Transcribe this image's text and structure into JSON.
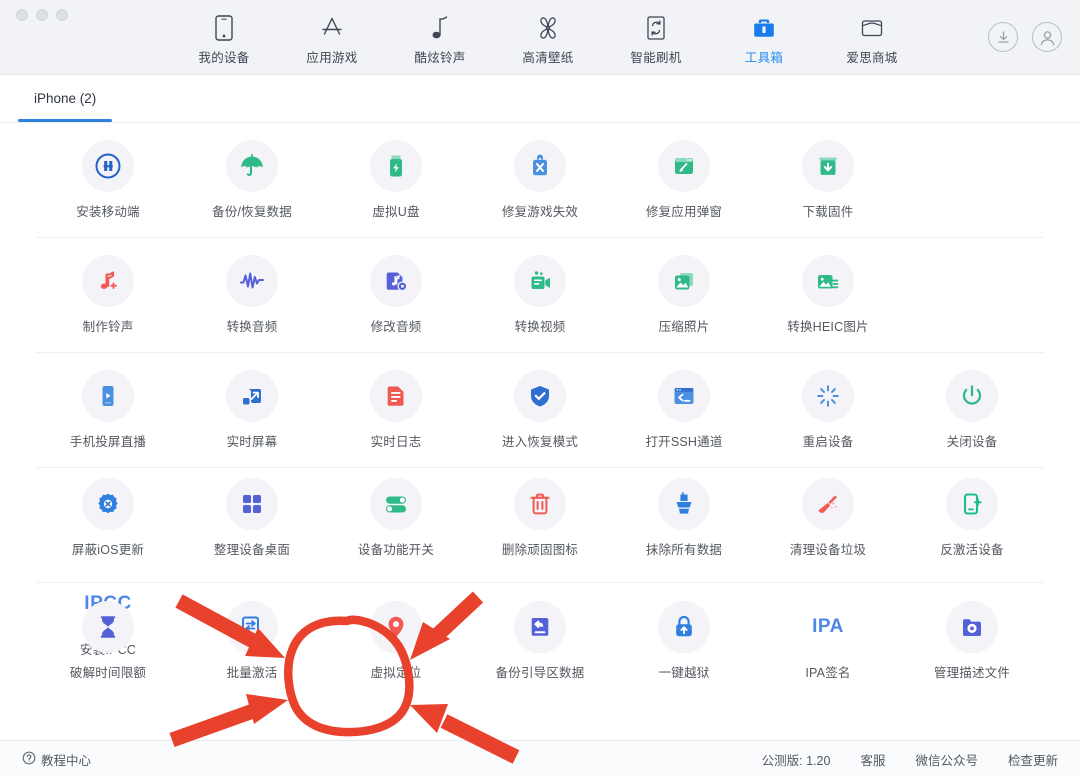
{
  "window": {
    "traffic_lights": [
      "close",
      "minimize",
      "maximize"
    ]
  },
  "colors": {
    "accent": "#2a8cf0",
    "tab_underline": "#2d7fe0",
    "annotation_red": "#e8412c",
    "topbar_bg": "#f1f3f6",
    "icon_bubble": "#f4f4f8"
  },
  "topnav": {
    "items": [
      {
        "label": "我的设备",
        "icon": "phone-icon",
        "active": false
      },
      {
        "label": "应用游戏",
        "icon": "appstore-icon",
        "active": false
      },
      {
        "label": "酷炫铃声",
        "icon": "music-note-icon",
        "active": false
      },
      {
        "label": "高清壁纸",
        "icon": "flower-icon",
        "active": false
      },
      {
        "label": "智能刷机",
        "icon": "flash-refresh-icon",
        "active": false
      },
      {
        "label": "工具箱",
        "icon": "toolbox-icon",
        "active": true
      },
      {
        "label": "爱思商城",
        "icon": "store-icon",
        "active": false
      }
    ],
    "right_buttons": [
      {
        "name": "download-icon"
      },
      {
        "name": "user-account-icon"
      }
    ]
  },
  "tabs": [
    {
      "label": "iPhone (2)",
      "active": true
    }
  ],
  "tool_rows": [
    [
      {
        "label": "安装移动端",
        "icon": "aisi-logo-icon",
        "color": "#2563c9"
      },
      {
        "label": "备份/恢复数据",
        "icon": "umbrella-icon",
        "color": "#2fba88"
      },
      {
        "label": "虚拟U盘",
        "icon": "usb-flash-icon",
        "color": "#2fba88"
      },
      {
        "label": "修复游戏失效",
        "icon": "game-repair-icon",
        "color": "#4a8fe0"
      },
      {
        "label": "修复应用弹窗",
        "icon": "popup-repair-icon",
        "color": "#2fba88"
      },
      {
        "label": "下载固件",
        "icon": "firmware-download-icon",
        "color": "#2fba88"
      }
    ],
    [
      {
        "label": "制作铃声",
        "icon": "ringtone-add-icon",
        "color": "#f15a52"
      },
      {
        "label": "转换音频",
        "icon": "waveform-icon",
        "color": "#5561d6"
      },
      {
        "label": "修改音频",
        "icon": "audio-edit-icon",
        "color": "#5561d6"
      },
      {
        "label": "转换视频",
        "icon": "video-camera-icon",
        "color": "#2fba88"
      },
      {
        "label": "压缩照片",
        "icon": "compress-photo-icon",
        "color": "#2fba88"
      },
      {
        "label": "转换HEIC图片",
        "icon": "heic-convert-icon",
        "color": "#2fba88"
      }
    ],
    [
      {
        "label": "手机投屏直播",
        "icon": "screen-cast-icon",
        "color": "#4a8fe0"
      },
      {
        "label": "实时屏幕",
        "icon": "realtime-screen-icon",
        "color": "#2f6fd0"
      },
      {
        "label": "实时日志",
        "icon": "log-file-icon",
        "color": "#f15a52"
      },
      {
        "label": "进入恢复模式",
        "icon": "shield-check-icon",
        "color": "#2f6fd0"
      },
      {
        "label": "打开SSH通道",
        "icon": "ssh-terminal-icon",
        "color": "#4a8fe0"
      },
      {
        "label": "重启设备",
        "icon": "restart-icon",
        "color": "#4a8fe0"
      },
      {
        "label": "关闭设备",
        "icon": "power-off-icon",
        "color": "#2fba88"
      }
    ],
    [
      {
        "label": "屏蔽iOS更新",
        "icon": "block-update-gear-icon",
        "color": "#2f7fe0"
      },
      {
        "label": "整理设备桌面",
        "icon": "grid-squares-icon",
        "color": "#5561d6"
      },
      {
        "label": "设备功能开关",
        "icon": "toggle-switch-icon",
        "color": "#2fba88"
      },
      {
        "label": "删除顽固图标",
        "icon": "trash-icon",
        "color": "#f15a52"
      },
      {
        "label": "抹除所有数据",
        "icon": "wipe-brush-icon",
        "color": "#2f7fe0"
      },
      {
        "label": "清理设备垃圾",
        "icon": "clean-broom-icon",
        "color": "#f15a52"
      },
      {
        "label": "反激活设备",
        "icon": "deactivate-phone-icon",
        "color": "#19bf8a"
      },
      {
        "label": "安装IPCC",
        "icon": "ipcc-text-icon",
        "color": "#4f86e8"
      }
    ],
    [
      {
        "label": "破解时间限额",
        "icon": "hourglass-icon",
        "color": "#5561d6"
      },
      {
        "label": "批量激活",
        "icon": "batch-activate-icon",
        "color": "#2f7fe0"
      },
      {
        "label": "虚拟定位",
        "icon": "location-pin-icon",
        "color": "#f15a52"
      },
      {
        "label": "备份引导区数据",
        "icon": "backup-boot-icon",
        "color": "#5561d6"
      },
      {
        "label": "一键越狱",
        "icon": "jailbreak-lock-icon",
        "color": "#2f7fe0"
      },
      {
        "label": "IPA签名",
        "icon": "ipa-text-icon",
        "color": "#4f86e8"
      },
      {
        "label": "管理描述文件",
        "icon": "profile-folder-icon",
        "color": "#5561d6"
      }
    ]
  ],
  "footer": {
    "left": {
      "label": "教程中心",
      "icon": "help-circle-icon"
    },
    "right": [
      {
        "label": "公测版: 1.20",
        "interactive": false
      },
      {
        "label": "客服",
        "interactive": true
      },
      {
        "label": "微信公众号",
        "interactive": true
      },
      {
        "label": "检查更新",
        "interactive": true
      }
    ]
  },
  "annotation": {
    "type": "hand-drawn-highlight",
    "target_label": "虚拟定位",
    "arrow_count": 4,
    "color": "#e8412c"
  }
}
